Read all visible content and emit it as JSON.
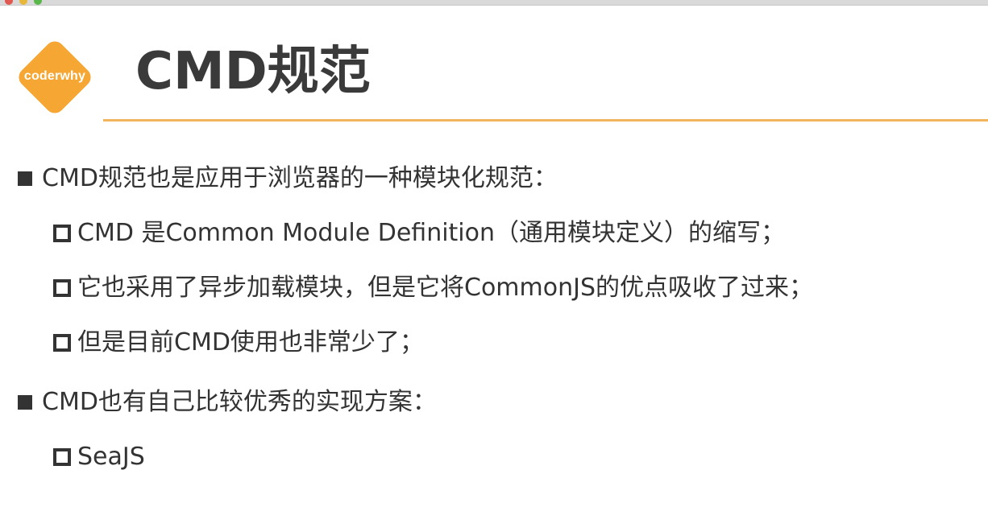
{
  "logo": {
    "text": "coderwhy",
    "color": "#f6a632"
  },
  "slide": {
    "title": "CMD规范",
    "accent_color": "#f0b45c",
    "bullets": [
      {
        "text": "CMD规范也是应用于浏览器的一种模块化规范：",
        "children": [
          {
            "text": "CMD 是Common Module Definition（通用模块定义）的缩写；"
          },
          {
            "text": "它也采用了异步加载模块，但是它将CommonJS的优点吸收了过来；"
          },
          {
            "text": "但是目前CMD使用也非常少了；"
          }
        ]
      },
      {
        "text": "CMD也有自己比较优秀的实现方案：",
        "children": [
          {
            "text": "SeaJS"
          }
        ]
      }
    ]
  }
}
